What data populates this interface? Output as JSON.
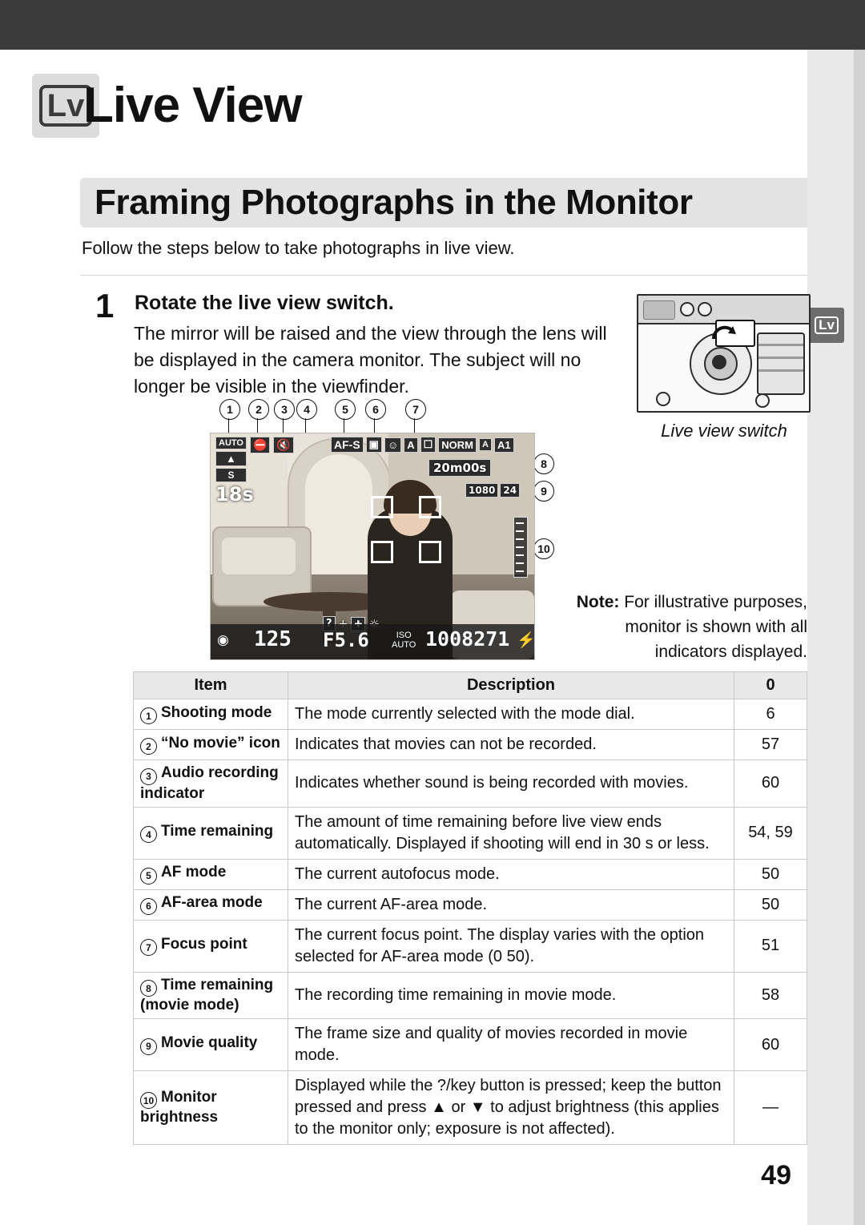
{
  "chapter": {
    "badge": "Lv",
    "title": "Live View"
  },
  "section": {
    "title": "Framing Photographs in the Monitor",
    "intro": "Follow the steps below to take photographs in live view."
  },
  "step": {
    "number": "1",
    "heading": "Rotate the live view switch.",
    "body": "The mirror will be raised and the view through the lens will be displayed in the camera monitor.  The subject will no longer be visible in the viewfinder."
  },
  "figure": {
    "camera_caption": "Live view switch",
    "rail_tab": "Lv",
    "callouts": [
      "1",
      "2",
      "3",
      "4",
      "5",
      "6",
      "7",
      "8",
      "9",
      "10"
    ],
    "monitor_osd": {
      "mode_auto": "AUTO",
      "no_movie": "movie-crossed-icon",
      "audio_off": "mic-off-icon",
      "release_mode": "S",
      "time_remaining": "18s",
      "af_mode": "AF-S",
      "af_area": "face-priority-icon",
      "picture_control": "A",
      "white_balance": "A",
      "image_quality": "NORM",
      "image_size": "A1",
      "movie_time": "20m00s",
      "movie_quality_size": "1080",
      "movie_quality_fps": "24",
      "shutter_speed": "125",
      "aperture": "F5.6",
      "iso_label": "ISO",
      "iso_value": "AUTO",
      "shots_remaining": "1008271",
      "flash_ready": "flash-icon",
      "brightness_help": "?/key + brightness"
    }
  },
  "note": {
    "label": "Note:",
    "text": " For illustrative purposes, monitor is shown with all indicators displayed."
  },
  "table": {
    "headers": [
      "Item",
      "Description",
      "0"
    ],
    "rows": [
      {
        "num": "1",
        "item": "Shooting mode",
        "desc": "The mode currently selected with the mode dial.",
        "page": "6"
      },
      {
        "num": "2",
        "item": "“No movie” icon",
        "desc": "Indicates that movies can not be recorded.",
        "page": "57"
      },
      {
        "num": "3",
        "item": "Audio recording indicator",
        "desc": "Indicates whether sound is being recorded with movies.",
        "page": "60"
      },
      {
        "num": "4",
        "item": "Time remaining",
        "desc": "The amount of time remaining before live view ends automatically.  Displayed if shooting will end in 30 s or less.",
        "page": "54, 59"
      },
      {
        "num": "5",
        "item": "AF mode",
        "desc": "The current autofocus mode.",
        "page": "50"
      },
      {
        "num": "6",
        "item": "AF-area mode",
        "desc": "The current AF-area mode.",
        "page": "50"
      },
      {
        "num": "7",
        "item": "Focus point",
        "desc": "The current focus point. The display varies with the option selected for AF-area mode (0 50).",
        "page": "51"
      },
      {
        "num": "8",
        "item": "Time remaining (movie mode)",
        "desc": "The recording time remaining in movie mode.",
        "page": "58"
      },
      {
        "num": "9",
        "item": "Movie quality",
        "desc": "The frame size and quality of movies recorded in movie mode.",
        "page": "60"
      },
      {
        "num": "10",
        "item": "Monitor brightness",
        "desc": "Displayed while the ?/key button is pressed; keep the button pressed and press ▲ or ▼ to adjust brightness (this applies to the monitor only; exposure is not affected).",
        "page": "—"
      }
    ]
  },
  "footer": {
    "page_number": "49"
  },
  "colors": {
    "topbar": "#3b3b3b",
    "section_bar": "#e3e3e3",
    "rail": "#e9e9e9"
  }
}
